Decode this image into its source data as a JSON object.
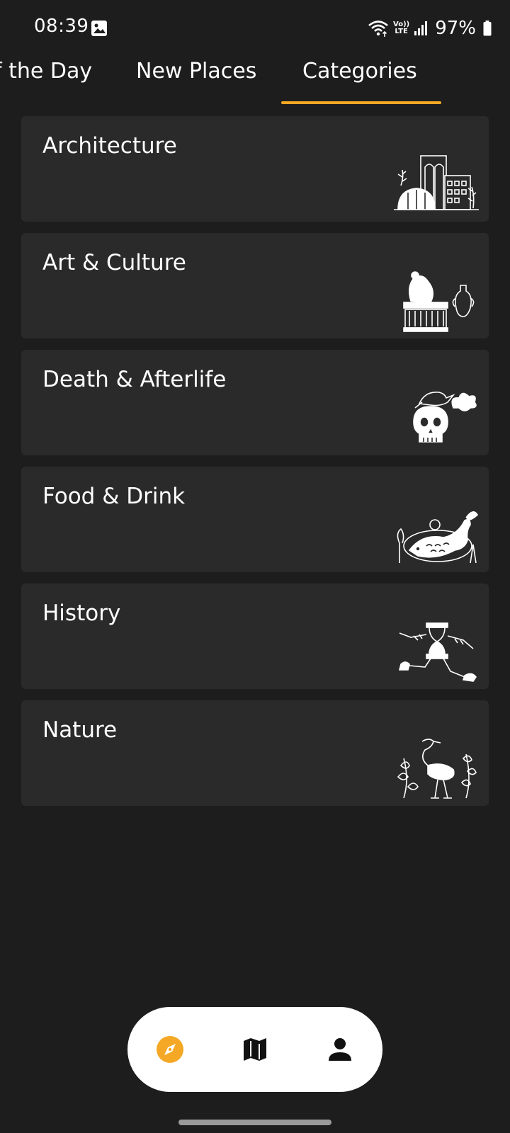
{
  "status_bar": {
    "time": "08:39",
    "volte_line1": "Vo))",
    "volte_line2": "LTE",
    "battery_text": "97%",
    "icons": [
      "gallery-icon",
      "wifi-icon",
      "volte-icon",
      "signal-icon",
      "battery-icon"
    ]
  },
  "tabs": [
    {
      "label": "f the Day",
      "selected": false
    },
    {
      "label": "New Places",
      "selected": false
    },
    {
      "label": "Categories",
      "selected": true
    }
  ],
  "accent_color": "#f4a825",
  "categories": [
    {
      "label": "Architecture",
      "icon": "architecture-illustration"
    },
    {
      "label": "Art & Culture",
      "icon": "art-culture-illustration"
    },
    {
      "label": "Death & Afterlife",
      "icon": "death-afterlife-illustration"
    },
    {
      "label": "Food & Drink",
      "icon": "food-drink-illustration"
    },
    {
      "label": "History",
      "icon": "history-illustration"
    },
    {
      "label": "Nature",
      "icon": "nature-illustration"
    }
  ],
  "bottom_nav": [
    {
      "name": "explore",
      "icon": "compass-icon",
      "active": true
    },
    {
      "name": "map",
      "icon": "map-icon",
      "active": false
    },
    {
      "name": "profile",
      "icon": "person-icon",
      "active": false
    }
  ]
}
